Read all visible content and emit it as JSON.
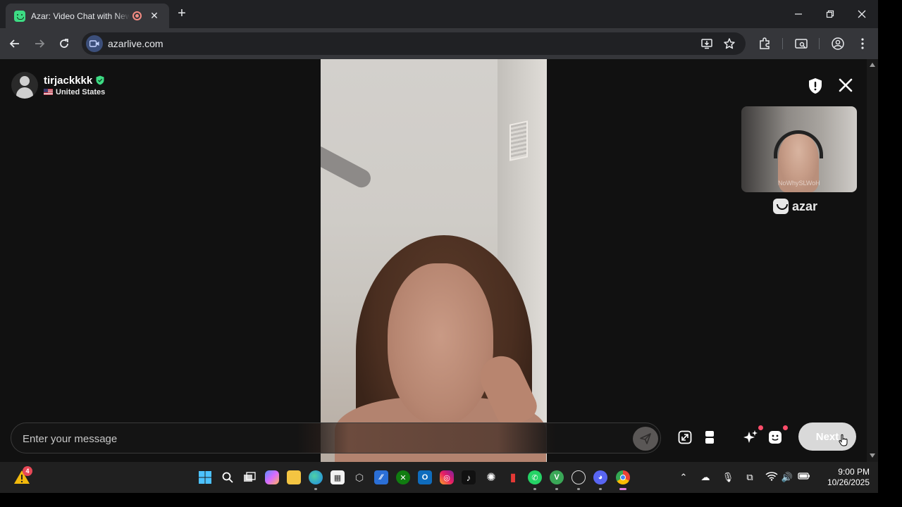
{
  "browser": {
    "tab_title": "Azar: Video Chat with New",
    "url": "azarlive.com"
  },
  "partner": {
    "username": "tirjackkkk",
    "country": "United States"
  },
  "self_view": {
    "watermark": "NoWhySLWoH"
  },
  "brand": {
    "name": "azar"
  },
  "chat": {
    "placeholder": "Enter your message"
  },
  "controls": {
    "next_label": "Next"
  },
  "taskbar": {
    "widget_badge": "4",
    "time": "9:00 PM",
    "date": "10/26/2025"
  },
  "colors": {
    "page_bg": "#111111",
    "accent_green": "#3ddc84",
    "next_button": "#d9d9d9",
    "notification_red": "#ff4d6a"
  },
  "icons": [
    "azar-favicon-icon",
    "recording-icon",
    "close-icon",
    "plus-icon",
    "minimize-icon",
    "maximize-icon",
    "back-arrow-icon",
    "forward-arrow-icon",
    "reload-icon",
    "site-info-icon",
    "install-app-icon",
    "star-icon",
    "extensions-icon",
    "reading-mode-icon",
    "profile-icon",
    "more-menu-icon",
    "verified-shield-icon",
    "us-flag-icon",
    "report-shield-icon",
    "send-icon",
    "expand-icon",
    "layout-icon",
    "sparkle-icon",
    "face-filter-icon",
    "windows-start-icon",
    "search-icon",
    "task-view-icon",
    "copilot-icon",
    "folder-icon",
    "edge-icon",
    "store-icon",
    "xbox-icon",
    "outlook-icon",
    "instagram-icon",
    "tiktok-icon",
    "chatgpt-icon",
    "whatsapp-icon",
    "discord-icon",
    "chrome-icon",
    "wifi-icon",
    "volume-icon",
    "battery-icon",
    "microphone-icon",
    "cloud-icon"
  ]
}
